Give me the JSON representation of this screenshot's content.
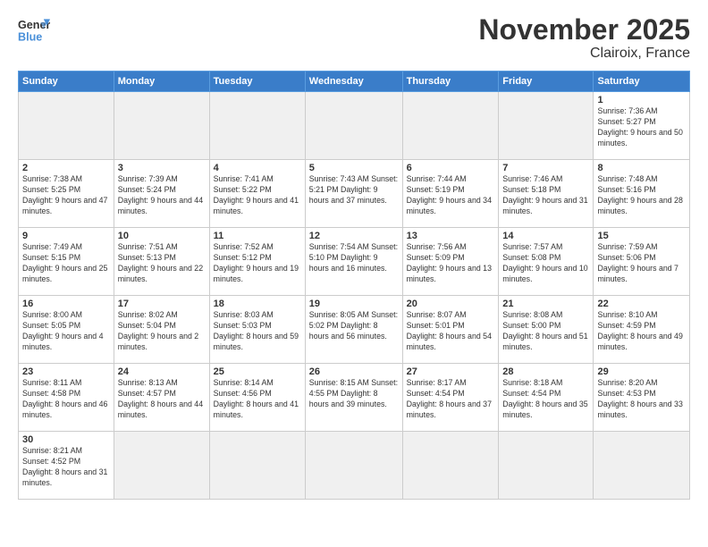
{
  "logo": {
    "line1": "General",
    "line2": "Blue"
  },
  "title": "November 2025",
  "subtitle": "Clairoix, France",
  "weekdays": [
    "Sunday",
    "Monday",
    "Tuesday",
    "Wednesday",
    "Thursday",
    "Friday",
    "Saturday"
  ],
  "rows": [
    [
      {
        "day": "",
        "info": ""
      },
      {
        "day": "",
        "info": ""
      },
      {
        "day": "",
        "info": ""
      },
      {
        "day": "",
        "info": ""
      },
      {
        "day": "",
        "info": ""
      },
      {
        "day": "",
        "info": ""
      },
      {
        "day": "1",
        "info": "Sunrise: 7:36 AM\nSunset: 5:27 PM\nDaylight: 9 hours\nand 50 minutes."
      }
    ],
    [
      {
        "day": "2",
        "info": "Sunrise: 7:38 AM\nSunset: 5:25 PM\nDaylight: 9 hours\nand 47 minutes."
      },
      {
        "day": "3",
        "info": "Sunrise: 7:39 AM\nSunset: 5:24 PM\nDaylight: 9 hours\nand 44 minutes."
      },
      {
        "day": "4",
        "info": "Sunrise: 7:41 AM\nSunset: 5:22 PM\nDaylight: 9 hours\nand 41 minutes."
      },
      {
        "day": "5",
        "info": "Sunrise: 7:43 AM\nSunset: 5:21 PM\nDaylight: 9 hours\nand 37 minutes."
      },
      {
        "day": "6",
        "info": "Sunrise: 7:44 AM\nSunset: 5:19 PM\nDaylight: 9 hours\nand 34 minutes."
      },
      {
        "day": "7",
        "info": "Sunrise: 7:46 AM\nSunset: 5:18 PM\nDaylight: 9 hours\nand 31 minutes."
      },
      {
        "day": "8",
        "info": "Sunrise: 7:48 AM\nSunset: 5:16 PM\nDaylight: 9 hours\nand 28 minutes."
      }
    ],
    [
      {
        "day": "9",
        "info": "Sunrise: 7:49 AM\nSunset: 5:15 PM\nDaylight: 9 hours\nand 25 minutes."
      },
      {
        "day": "10",
        "info": "Sunrise: 7:51 AM\nSunset: 5:13 PM\nDaylight: 9 hours\nand 22 minutes."
      },
      {
        "day": "11",
        "info": "Sunrise: 7:52 AM\nSunset: 5:12 PM\nDaylight: 9 hours\nand 19 minutes."
      },
      {
        "day": "12",
        "info": "Sunrise: 7:54 AM\nSunset: 5:10 PM\nDaylight: 9 hours\nand 16 minutes."
      },
      {
        "day": "13",
        "info": "Sunrise: 7:56 AM\nSunset: 5:09 PM\nDaylight: 9 hours\nand 13 minutes."
      },
      {
        "day": "14",
        "info": "Sunrise: 7:57 AM\nSunset: 5:08 PM\nDaylight: 9 hours\nand 10 minutes."
      },
      {
        "day": "15",
        "info": "Sunrise: 7:59 AM\nSunset: 5:06 PM\nDaylight: 9 hours\nand 7 minutes."
      }
    ],
    [
      {
        "day": "16",
        "info": "Sunrise: 8:00 AM\nSunset: 5:05 PM\nDaylight: 9 hours\nand 4 minutes."
      },
      {
        "day": "17",
        "info": "Sunrise: 8:02 AM\nSunset: 5:04 PM\nDaylight: 9 hours\nand 2 minutes."
      },
      {
        "day": "18",
        "info": "Sunrise: 8:03 AM\nSunset: 5:03 PM\nDaylight: 8 hours\nand 59 minutes."
      },
      {
        "day": "19",
        "info": "Sunrise: 8:05 AM\nSunset: 5:02 PM\nDaylight: 8 hours\nand 56 minutes."
      },
      {
        "day": "20",
        "info": "Sunrise: 8:07 AM\nSunset: 5:01 PM\nDaylight: 8 hours\nand 54 minutes."
      },
      {
        "day": "21",
        "info": "Sunrise: 8:08 AM\nSunset: 5:00 PM\nDaylight: 8 hours\nand 51 minutes."
      },
      {
        "day": "22",
        "info": "Sunrise: 8:10 AM\nSunset: 4:59 PM\nDaylight: 8 hours\nand 49 minutes."
      }
    ],
    [
      {
        "day": "23",
        "info": "Sunrise: 8:11 AM\nSunset: 4:58 PM\nDaylight: 8 hours\nand 46 minutes."
      },
      {
        "day": "24",
        "info": "Sunrise: 8:13 AM\nSunset: 4:57 PM\nDaylight: 8 hours\nand 44 minutes."
      },
      {
        "day": "25",
        "info": "Sunrise: 8:14 AM\nSunset: 4:56 PM\nDaylight: 8 hours\nand 41 minutes."
      },
      {
        "day": "26",
        "info": "Sunrise: 8:15 AM\nSunset: 4:55 PM\nDaylight: 8 hours\nand 39 minutes."
      },
      {
        "day": "27",
        "info": "Sunrise: 8:17 AM\nSunset: 4:54 PM\nDaylight: 8 hours\nand 37 minutes."
      },
      {
        "day": "28",
        "info": "Sunrise: 8:18 AM\nSunset: 4:54 PM\nDaylight: 8 hours\nand 35 minutes."
      },
      {
        "day": "29",
        "info": "Sunrise: 8:20 AM\nSunset: 4:53 PM\nDaylight: 8 hours\nand 33 minutes."
      }
    ],
    [
      {
        "day": "30",
        "info": "Sunrise: 8:21 AM\nSunset: 4:52 PM\nDaylight: 8 hours\nand 31 minutes."
      },
      {
        "day": "",
        "info": ""
      },
      {
        "day": "",
        "info": ""
      },
      {
        "day": "",
        "info": ""
      },
      {
        "day": "",
        "info": ""
      },
      {
        "day": "",
        "info": ""
      },
      {
        "day": "",
        "info": ""
      }
    ]
  ]
}
